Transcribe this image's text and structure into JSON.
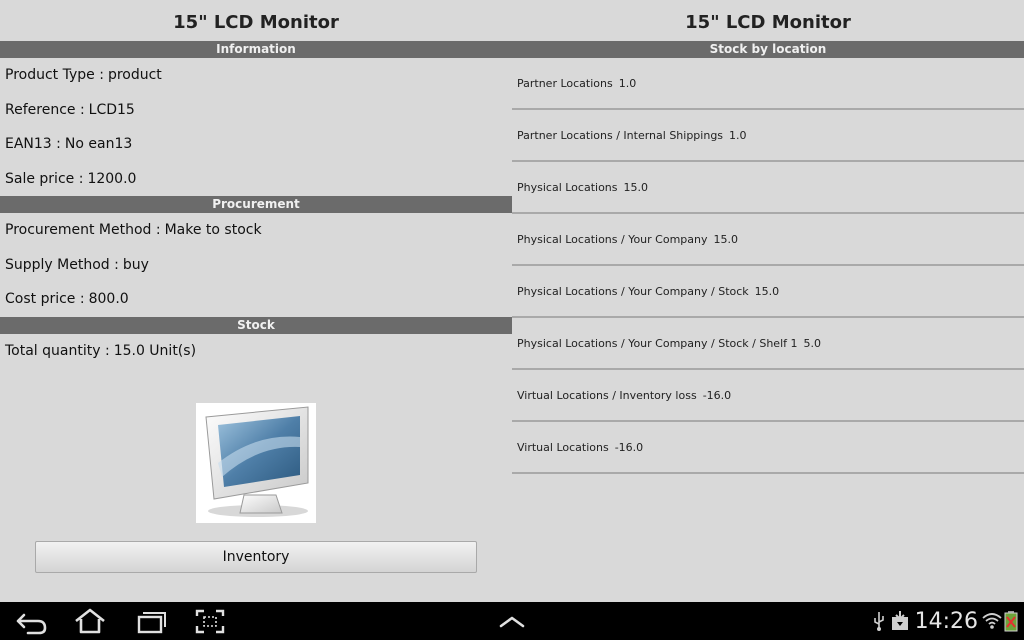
{
  "left_pane": {
    "title": "15\" LCD Monitor",
    "sections": {
      "information": {
        "header": "Information",
        "fields": [
          {
            "label": "Product Type :",
            "value": "product"
          },
          {
            "label": "Reference :",
            "value": "LCD15"
          },
          {
            "label": "EAN13 :",
            "value": "No ean13"
          },
          {
            "label": "Sale price :",
            "value": "1200.0"
          }
        ]
      },
      "procurement": {
        "header": "Procurement",
        "fields": [
          {
            "label": "Procurement Method :",
            "value": "Make to stock"
          },
          {
            "label": "Supply Method :",
            "value": "buy"
          },
          {
            "label": "Cost price :",
            "value": "800.0"
          }
        ]
      },
      "stock": {
        "header": "Stock",
        "fields": [
          {
            "label": "Total quantity :",
            "value": "15.0 Unit(s)"
          }
        ]
      }
    },
    "inventory_button": "Inventory"
  },
  "right_pane": {
    "title": "15\" LCD Monitor",
    "header": "Stock by location",
    "locations": [
      {
        "name": "Partner Locations",
        "qty": "1.0"
      },
      {
        "name": "Partner Locations / Internal Shippings",
        "qty": "1.0"
      },
      {
        "name": "Physical Locations",
        "qty": "15.0"
      },
      {
        "name": "Physical Locations / Your Company",
        "qty": "15.0"
      },
      {
        "name": "Physical Locations / Your Company / Stock",
        "qty": "15.0"
      },
      {
        "name": "Physical Locations / Your Company / Stock / Shelf 1",
        "qty": "5.0"
      },
      {
        "name": "Virtual Locations / Inventory loss",
        "qty": "-16.0"
      },
      {
        "name": "Virtual Locations",
        "qty": "-16.0"
      }
    ]
  },
  "system_bar": {
    "clock": "14:26",
    "icons": [
      "back-icon",
      "home-icon",
      "recent-apps-icon",
      "screenshot-icon",
      "up-chevron-icon",
      "usb-icon",
      "download-icon",
      "wifi-icon",
      "battery-icon"
    ]
  }
}
